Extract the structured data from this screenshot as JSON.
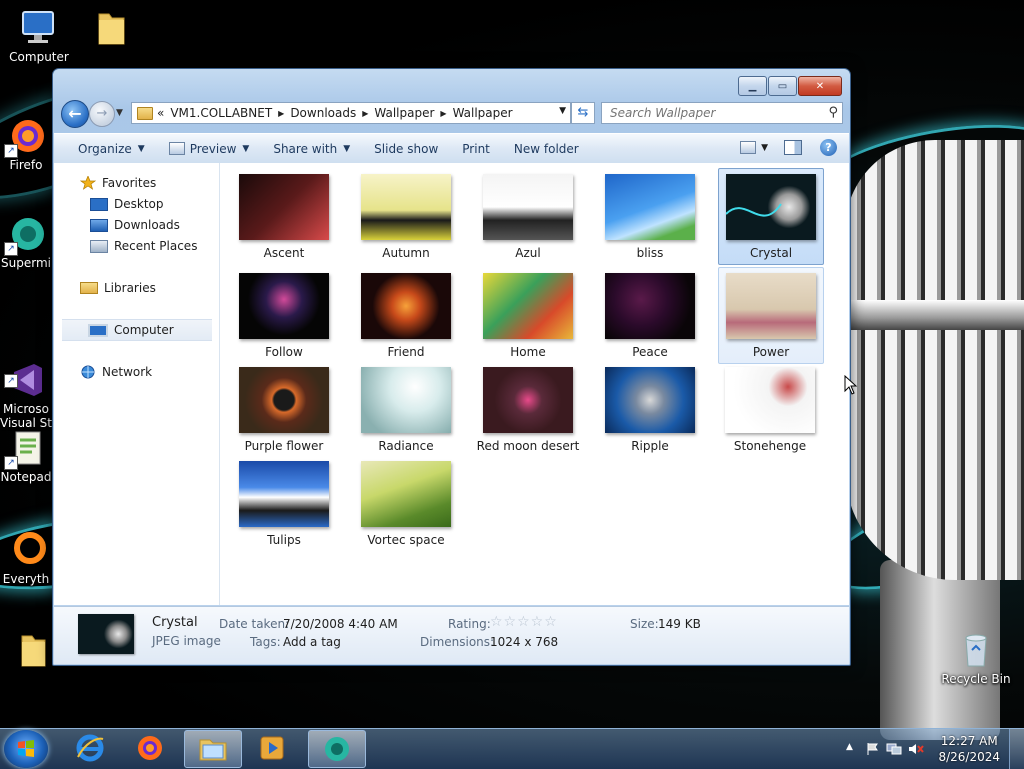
{
  "desktop": {
    "icons": [
      {
        "label": "Computer"
      },
      {
        "label": ""
      },
      {
        "label": "Firefo"
      },
      {
        "label": "Supermi"
      },
      {
        "label": "Microso\nVisual St"
      },
      {
        "label": "Notepad"
      },
      {
        "label": "Everyth"
      },
      {
        "label": ""
      },
      {
        "label": "Recycle Bin"
      }
    ]
  },
  "window": {
    "address": {
      "overflow": "«",
      "crumbs": [
        "VM1.COLLABNET",
        "Downloads",
        "Wallpaper",
        "Wallpaper"
      ]
    },
    "search": {
      "placeholder": "Search Wallpaper"
    },
    "toolbar": {
      "organize": "Organize",
      "preview": "Preview",
      "share_with": "Share with",
      "slide_show": "Slide show",
      "print": "Print",
      "new_folder": "New folder"
    },
    "nav": {
      "favorites": "Favorites",
      "desktop": "Desktop",
      "downloads": "Downloads",
      "recent": "Recent Places",
      "libraries": "Libraries",
      "computer": "Computer",
      "network": "Network"
    },
    "files": [
      {
        "name": "Ascent"
      },
      {
        "name": "Autumn"
      },
      {
        "name": "Azul"
      },
      {
        "name": "bliss"
      },
      {
        "name": "Crystal"
      },
      {
        "name": "Follow"
      },
      {
        "name": "Friend"
      },
      {
        "name": "Home"
      },
      {
        "name": "Peace"
      },
      {
        "name": "Power"
      },
      {
        "name": "Purple flower"
      },
      {
        "name": "Radiance"
      },
      {
        "name": "Red moon desert"
      },
      {
        "name": "Ripple"
      },
      {
        "name": "Stonehenge"
      },
      {
        "name": "Tulips"
      },
      {
        "name": "Vortec space"
      }
    ],
    "selected_file": "Crystal",
    "details": {
      "name": "Crystal",
      "type": "JPEG image",
      "date_label": "Date taken:",
      "date_value": "7/20/2008 4:40 AM",
      "tags_label": "Tags:",
      "tags_value": "Add a tag",
      "rating_label": "Rating:",
      "rating_stars": "☆☆☆☆☆",
      "dimensions_label": "Dimensions:",
      "dimensions_value": "1024 x 768",
      "size_label": "Size:",
      "size_value": "149 KB"
    }
  },
  "taskbar": {
    "time": "12:27 AM",
    "date": "8/26/2024",
    "tray_expand": "▲"
  },
  "colors": {
    "accent": "#1f5fb3",
    "selection": "#c4dcf7",
    "wallpaper_glow": "#40dceb"
  }
}
